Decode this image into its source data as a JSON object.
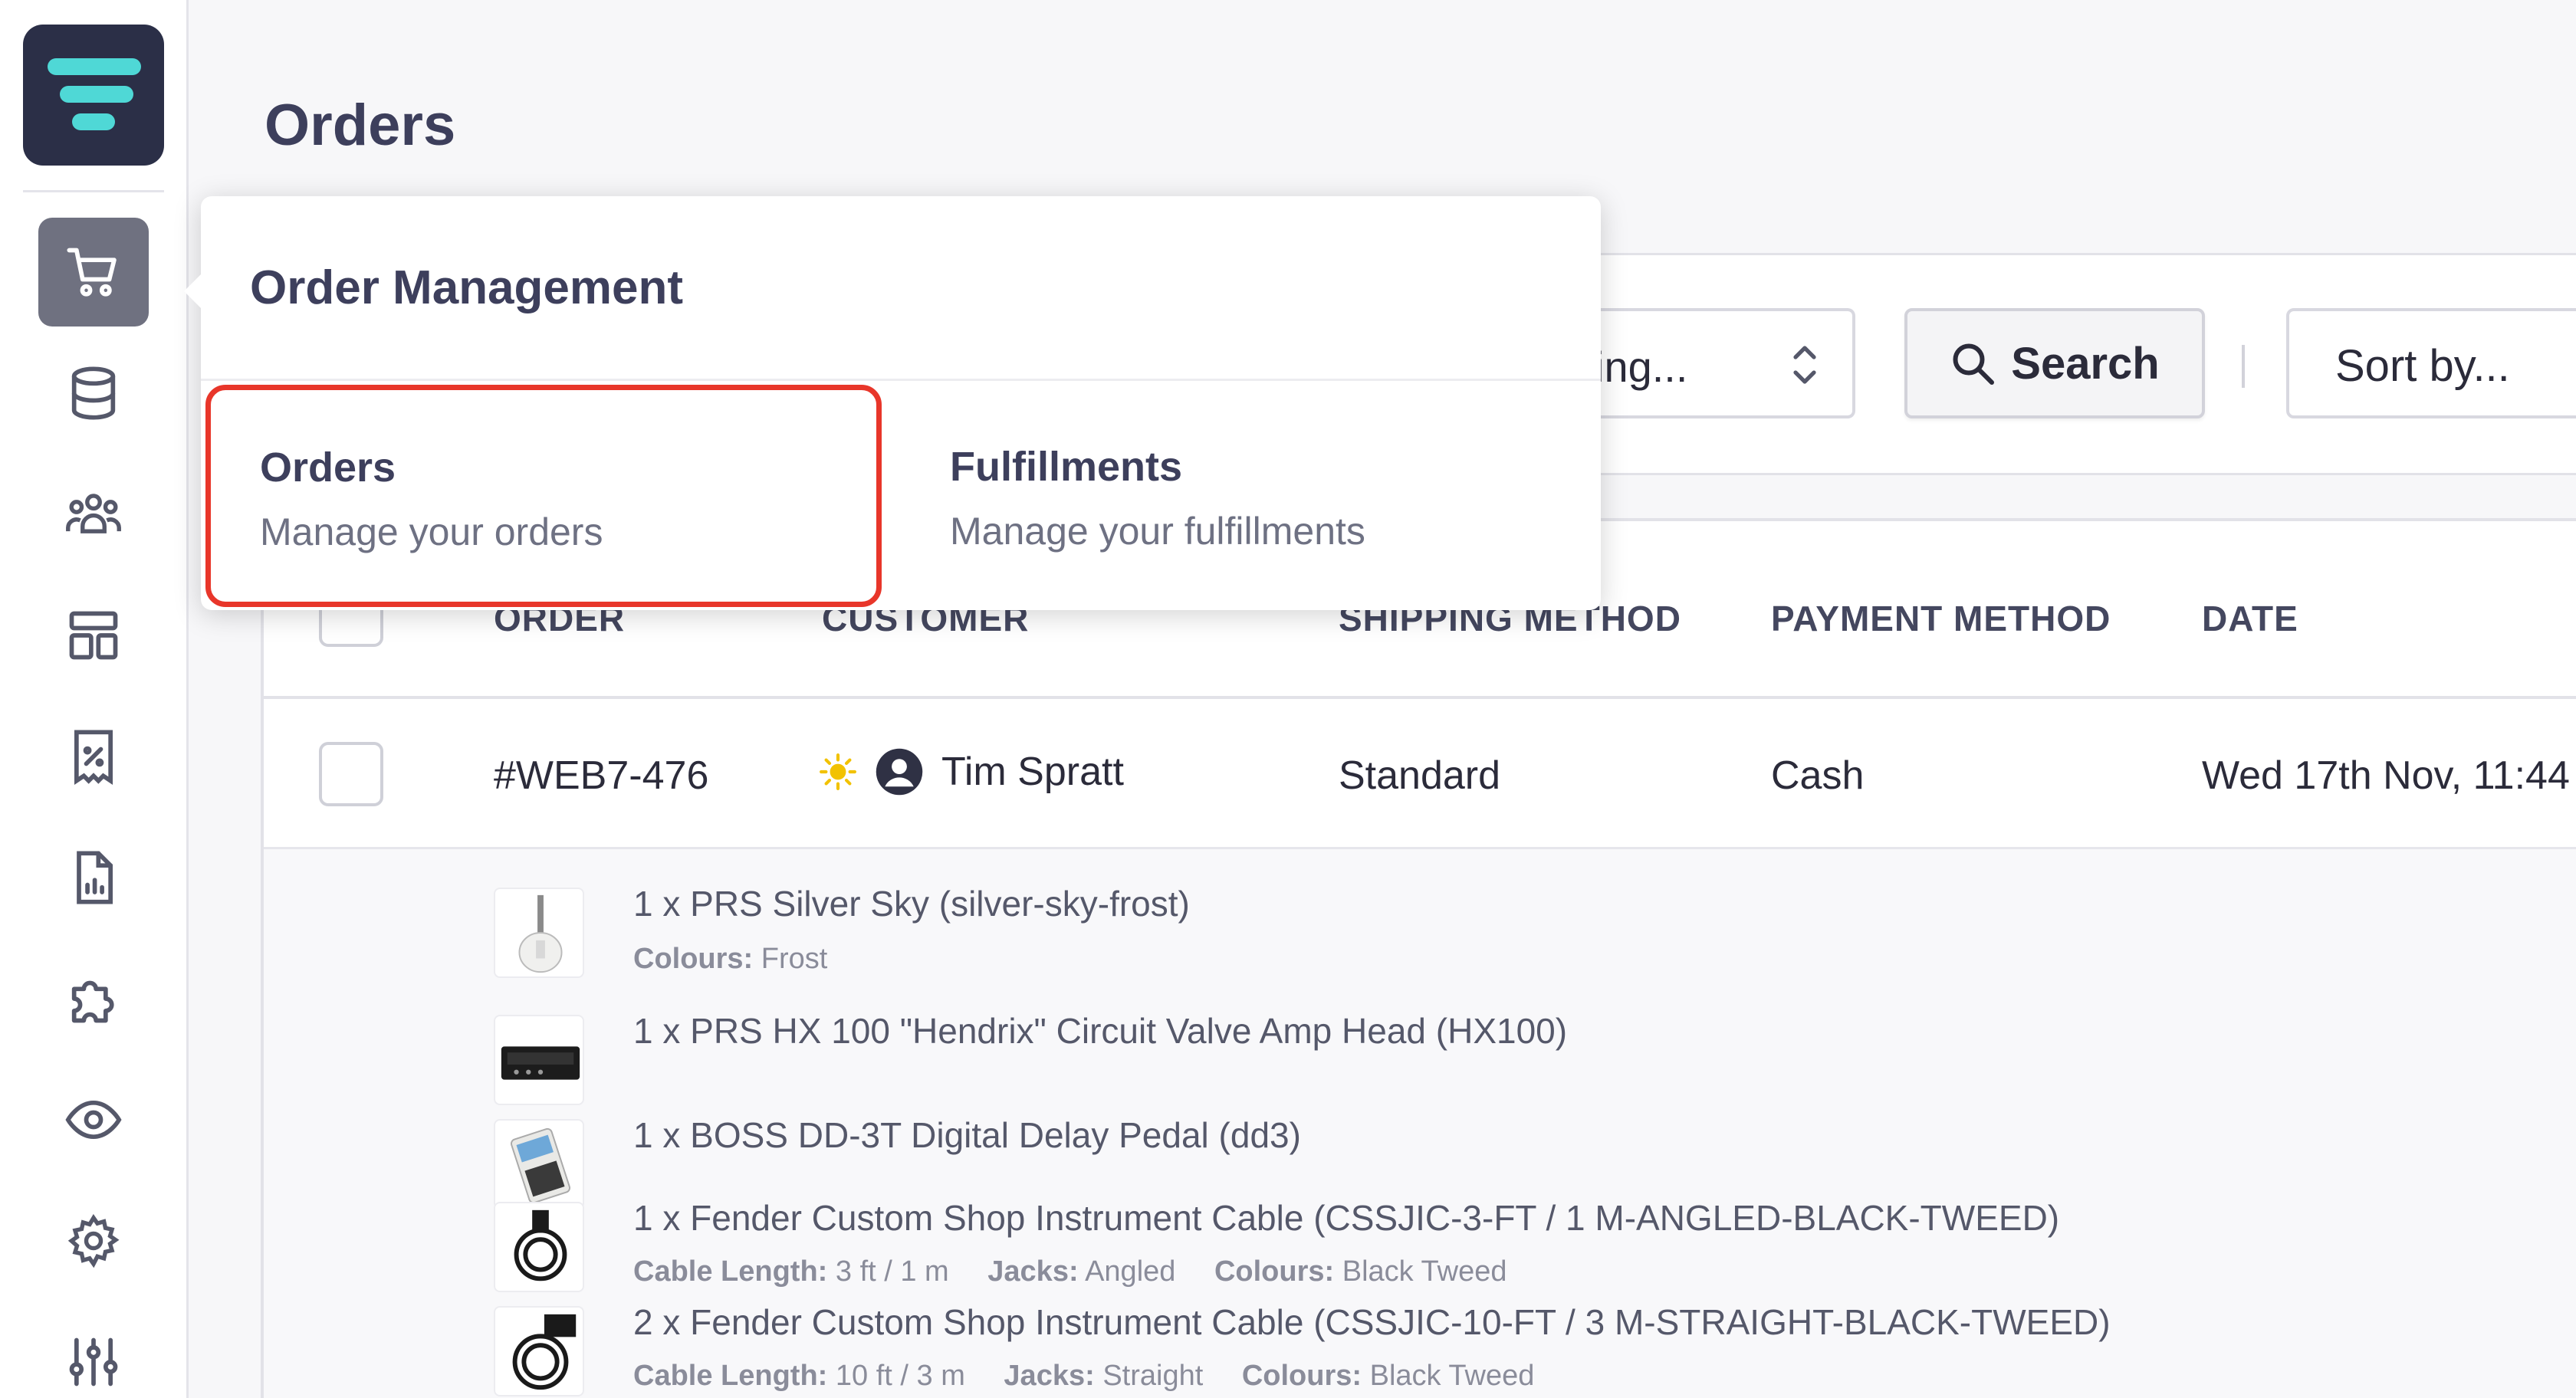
{
  "page": {
    "title": "Orders"
  },
  "sidebar": {
    "items": [
      {
        "icon": "shopping-cart-icon",
        "active": true
      },
      {
        "icon": "database-icon"
      },
      {
        "icon": "users-group-icon"
      },
      {
        "icon": "layout-icon"
      },
      {
        "icon": "discount-receipt-icon"
      },
      {
        "icon": "report-document-icon"
      },
      {
        "icon": "puzzle-plugin-icon"
      },
      {
        "icon": "eye-icon"
      },
      {
        "icon": "gear-icon"
      },
      {
        "icon": "sliders-icon"
      }
    ]
  },
  "popover": {
    "title": "Order Management",
    "items": [
      {
        "label": "Orders",
        "description": "Manage your orders",
        "highlighted": true
      },
      {
        "label": "Fulfillments",
        "description": "Manage your fulfillments"
      }
    ]
  },
  "toolbar": {
    "select_partial": "ing...",
    "search_label": "Search",
    "sort_label": "Sort by..."
  },
  "table": {
    "columns": [
      "ORDER",
      "CUSTOMER",
      "SHIPPING METHOD",
      "PAYMENT METHOD",
      "DATE"
    ],
    "row": {
      "order": "#WEB7-476",
      "customer": "Tim Spratt",
      "shipping": "Standard",
      "payment": "Cash",
      "date": "Wed 17th Nov, 11:44"
    },
    "items": [
      {
        "title": "1 x PRS Silver Sky (silver-sky-frost)",
        "meta": [
          {
            "k": "Colours:",
            "v": "Frost"
          }
        ]
      },
      {
        "title": "1 x PRS HX 100 \"Hendrix\" Circuit Valve Amp Head (HX100)",
        "meta": []
      },
      {
        "title": "1 x BOSS DD-3T Digital Delay Pedal (dd3)",
        "meta": []
      },
      {
        "title": "1 x Fender Custom Shop Instrument Cable (CSSJIC-3-FT / 1 M-ANGLED-BLACK-TWEED)",
        "meta": [
          {
            "k": "Cable Length:",
            "v": "3 ft / 1 m"
          },
          {
            "k": "Jacks:",
            "v": "Angled"
          },
          {
            "k": "Colours:",
            "v": "Black Tweed"
          }
        ]
      },
      {
        "title": "2 x Fender Custom Shop Instrument Cable (CSSJIC-10-FT / 3 M-STRAIGHT-BLACK-TWEED)",
        "meta": [
          {
            "k": "Cable Length:",
            "v": "10 ft / 3 m"
          },
          {
            "k": "Jacks:",
            "v": "Straight"
          },
          {
            "k": "Colours:",
            "v": "Black Tweed"
          }
        ]
      }
    ]
  },
  "colors": {
    "highlight": "#e8362a",
    "logo_bg": "#2b2f47",
    "logo_accent": "#4fd8d6"
  }
}
